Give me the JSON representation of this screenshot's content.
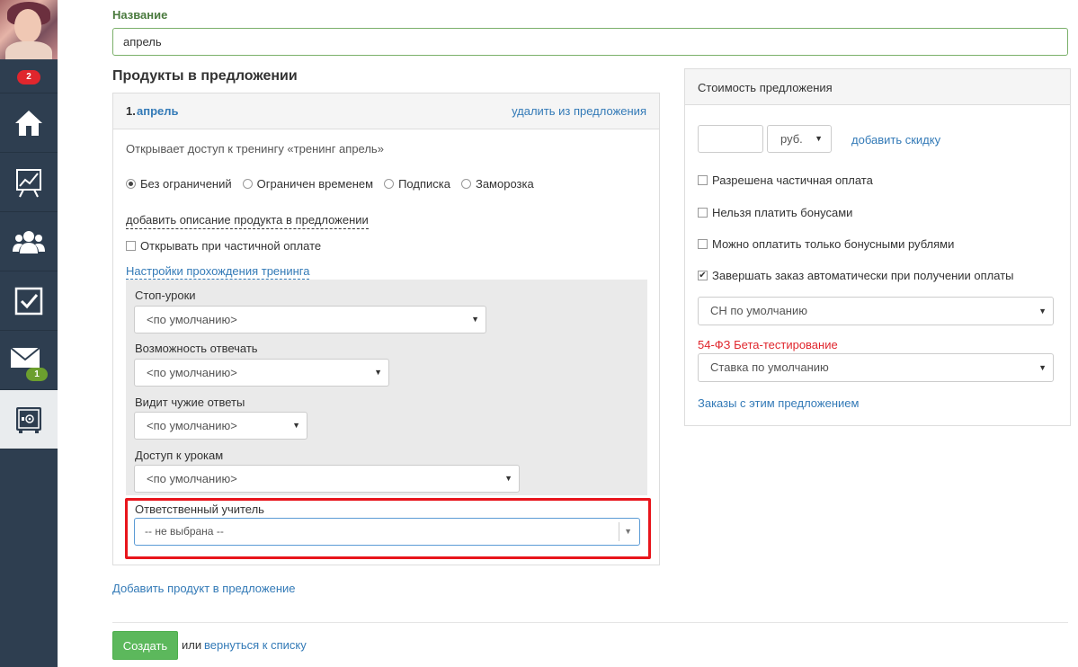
{
  "sidebar": {
    "notif_count": "2",
    "mail_count": "1",
    "items": [
      {
        "icon": "home-icon"
      },
      {
        "icon": "chart-icon"
      },
      {
        "icon": "users-icon"
      },
      {
        "icon": "checkbox-icon"
      },
      {
        "icon": "mail-icon"
      },
      {
        "icon": "safe-icon"
      }
    ]
  },
  "form": {
    "name_label": "Название",
    "name_value": "апрель",
    "products_title": "Продукты в предложении"
  },
  "product": {
    "number": "1.",
    "name": "апрель",
    "remove_link": "удалить из предложения",
    "description": "Открывает доступ к тренингу «тренинг апрель»",
    "access_options": [
      "Без ограничений",
      "Ограничен временем",
      "Подписка",
      "Заморозка"
    ],
    "selected_access": "Без ограничений",
    "add_description_link": "добавить описание продукта в предложении",
    "partial_payment_open": "Открывать при частичной оплате",
    "training_settings_link": "Настройки прохождения тренинга",
    "settings": [
      {
        "label": "Стоп-уроки",
        "value": "<по умолчанию>"
      },
      {
        "label": "Возможность отвечать",
        "value": "<по умолчанию>"
      },
      {
        "label": "Видит чужие ответы",
        "value": "<по умолчанию>"
      },
      {
        "label": "Доступ к урокам",
        "value": "<по умолчанию>"
      }
    ],
    "teacher_label": "Ответственный учитель",
    "teacher_value": "-- не выбрана --"
  },
  "actions": {
    "add_product": "Добавить продукт в предложение",
    "create_button": "Создать",
    "or_text": "или",
    "back_link": "вернуться к списку"
  },
  "cost": {
    "title": "Стоимость предложения",
    "price_value": "",
    "currency": "руб.",
    "add_discount": "добавить скидку",
    "options": [
      {
        "label": "Разрешена частичная оплата",
        "checked": false
      },
      {
        "label": "Нельзя платить бонусами",
        "checked": false
      },
      {
        "label": "Можно оплатить только бонусными рублями",
        "checked": false
      },
      {
        "label": "Завершать заказ автоматически при получении оплаты",
        "checked": true
      }
    ],
    "tax_select": "СН по умолчанию",
    "fz_label": "54-ФЗ Бета-тестирование",
    "rate_select": "Ставка по умолчанию",
    "orders_link": "Заказы с этим предложением"
  },
  "colors": {
    "sidebar_bg": "#2e3e50",
    "link": "#337ab7",
    "label_green": "#4a7a3e",
    "create_green": "#5cb85c",
    "highlight_red": "#e8151c"
  }
}
